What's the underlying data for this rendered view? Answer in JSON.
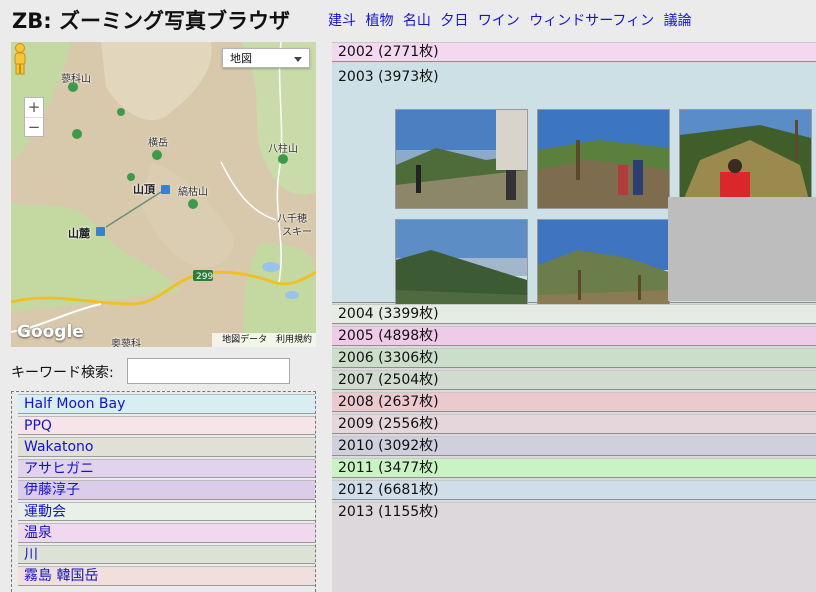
{
  "app_title": "ZB: ズーミング写真ブラウザ",
  "nav_links": [
    "建斗",
    "植物",
    "名山",
    "夕日",
    "ワイン",
    "ウィンドサーフィン",
    "議論"
  ],
  "map": {
    "type_selector": "地図",
    "zoom_in": "+",
    "zoom_out": "−",
    "labels": {
      "mt_tsurugi": "蓼科山",
      "yokodake": "横岳",
      "yatsugatake": "八柱山",
      "sancho": "山頂",
      "shimagare": "縞枯山",
      "hachisen": "八千穂",
      "ski": "スキー",
      "sanroku": "山麓",
      "route": "299",
      "oku": "奥蓼科"
    },
    "logo": "Google",
    "footer_data": "地図データ",
    "footer_terms": "利用規約"
  },
  "search": {
    "label": "キーワード検索:",
    "value": ""
  },
  "keywords": [
    {
      "label": "Half Moon Bay",
      "color": "#d7eef2"
    },
    {
      "label": "PPQ",
      "color": "#f6e4e8"
    },
    {
      "label": "Wakatono",
      "color": "#e0e0d6"
    },
    {
      "label": "アサヒガニ",
      "color": "#e2d2ec"
    },
    {
      "label": "伊藤淳子",
      "color": "#dcccec"
    },
    {
      "label": "運動会",
      "color": "#e8f0e8"
    },
    {
      "label": "温泉",
      "color": "#f0d8ee"
    },
    {
      "label": "川",
      "color": "#dde2d6"
    },
    {
      "label": "霧島 韓国岳",
      "color": "#f0dfdc"
    }
  ],
  "years": [
    {
      "label": "2002 (2771枚)",
      "color": "#f4d8f0"
    },
    {
      "label": "2003 (3973枚)",
      "color": "#cde0e6"
    },
    {
      "label": "2004 (3399枚)",
      "color": "#e6ece3"
    },
    {
      "label": "2005 (4898枚)",
      "color": "#f0cbe9"
    },
    {
      "label": "2006 (3306枚)",
      "color": "#cbdeca"
    },
    {
      "label": "2007 (2504枚)",
      "color": "#d2dbd0"
    },
    {
      "label": "2008 (2637枚)",
      "color": "#ecc8cf"
    },
    {
      "label": "2009 (2556枚)",
      "color": "#e5d6dc"
    },
    {
      "label": "2010 (3092枚)",
      "color": "#cfcfdd"
    },
    {
      "label": "2011 (3477枚)",
      "color": "#c9f3c2"
    },
    {
      "label": "2012 (6681枚)",
      "color": "#cfdee8"
    },
    {
      "label": "2013 (1155枚)",
      "color": "#ddd8dc"
    }
  ],
  "expanded_year_index": 1,
  "thumbnails": [
    "mountain-trail-photo",
    "hikers-on-trail-photo",
    "hiker-red-jacket-photo",
    "mountain-vista-photo",
    "mountain-slope-photo"
  ]
}
